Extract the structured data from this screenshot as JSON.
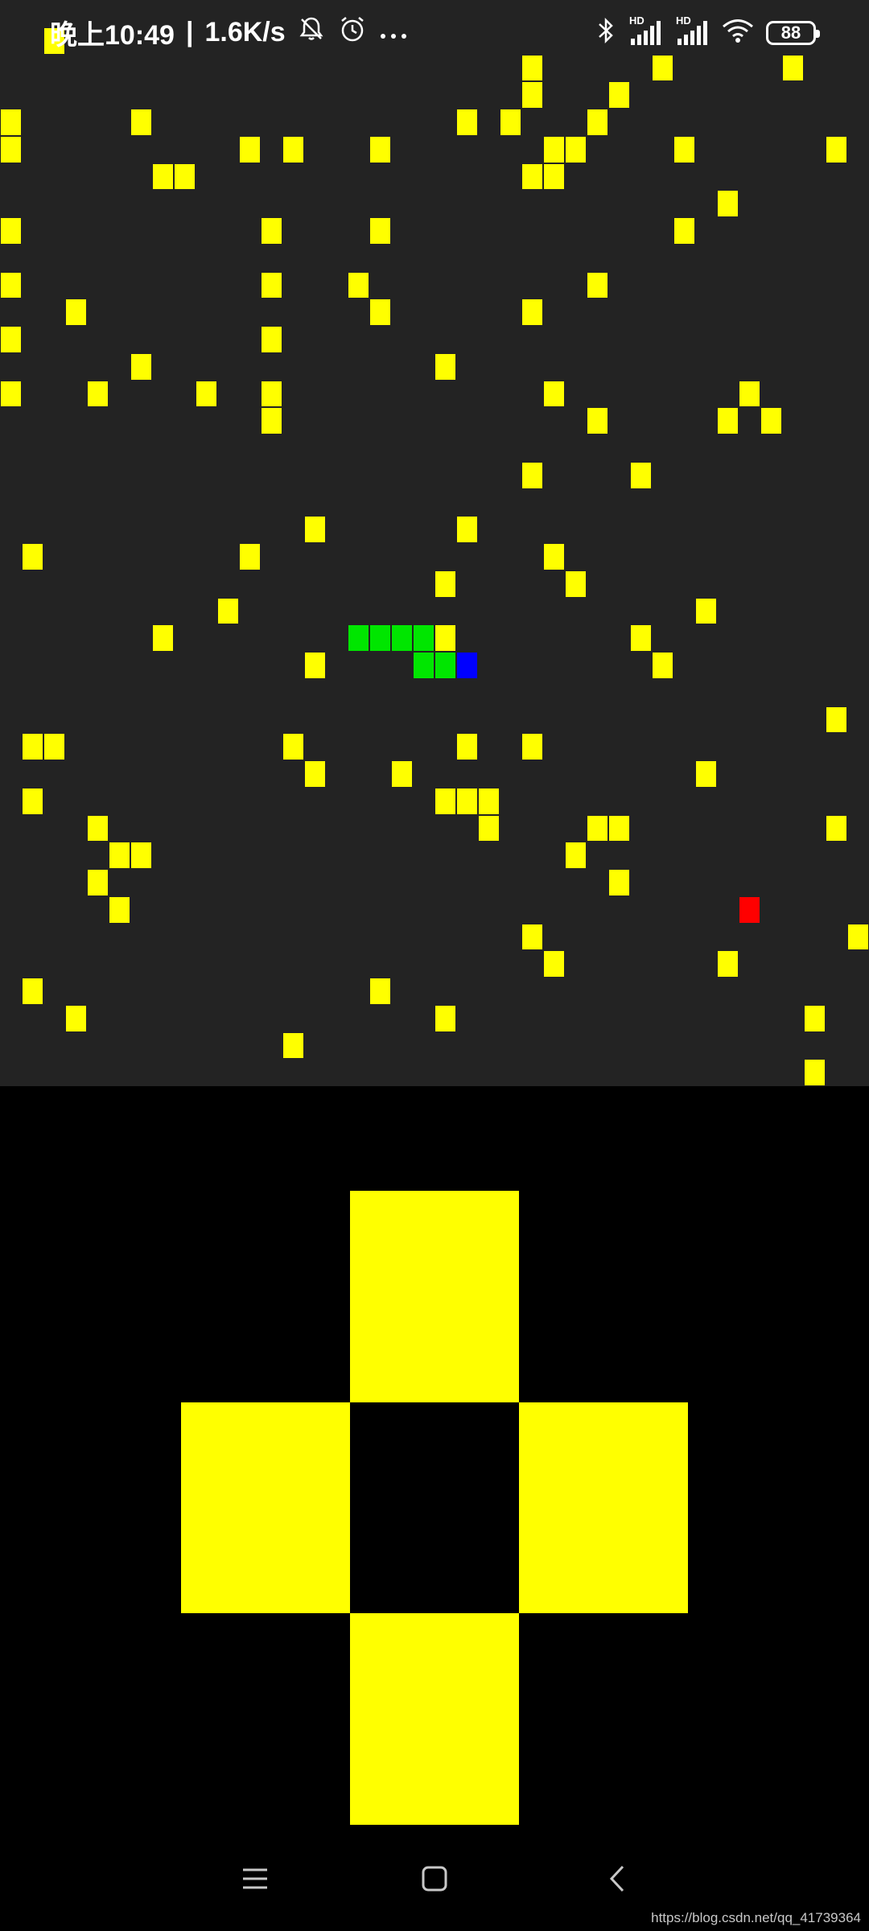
{
  "status_bar": {
    "time": "晚上10:49",
    "net_speed": "1.6K/s",
    "battery": "88",
    "signal_labels": [
      "HD",
      "HD"
    ],
    "icons": [
      "mute-bell-icon",
      "alarm-icon",
      "more-dots-icon",
      "bluetooth-icon",
      "signal-icon",
      "signal-icon",
      "wifi-icon",
      "battery-icon"
    ]
  },
  "game": {
    "cols": 40,
    "rows": 40,
    "colors": {
      "empty": "#232323",
      "wall": "#ffff00",
      "snake_body": "#00e600",
      "snake_head": "#0000ff",
      "food": "#ff0000"
    },
    "walls": [
      [
        2,
        1
      ],
      [
        24,
        2
      ],
      [
        30,
        2
      ],
      [
        36,
        2
      ],
      [
        24,
        3
      ],
      [
        28,
        3
      ],
      [
        0,
        4
      ],
      [
        6,
        4
      ],
      [
        21,
        4
      ],
      [
        23,
        4
      ],
      [
        27,
        4
      ],
      [
        0,
        5
      ],
      [
        11,
        5
      ],
      [
        13,
        5
      ],
      [
        17,
        5
      ],
      [
        25,
        5
      ],
      [
        26,
        5
      ],
      [
        31,
        5
      ],
      [
        38,
        5
      ],
      [
        7,
        6
      ],
      [
        8,
        6
      ],
      [
        24,
        6
      ],
      [
        25,
        6
      ],
      [
        33,
        7
      ],
      [
        0,
        8
      ],
      [
        12,
        8
      ],
      [
        17,
        8
      ],
      [
        31,
        8
      ],
      [
        0,
        10
      ],
      [
        12,
        10
      ],
      [
        16,
        10
      ],
      [
        27,
        10
      ],
      [
        3,
        11
      ],
      [
        17,
        11
      ],
      [
        24,
        11
      ],
      [
        0,
        12
      ],
      [
        12,
        12
      ],
      [
        6,
        13
      ],
      [
        20,
        13
      ],
      [
        0,
        14
      ],
      [
        4,
        14
      ],
      [
        9,
        14
      ],
      [
        12,
        14
      ],
      [
        25,
        14
      ],
      [
        34,
        14
      ],
      [
        12,
        15
      ],
      [
        27,
        15
      ],
      [
        33,
        15
      ],
      [
        35,
        15
      ],
      [
        24,
        17
      ],
      [
        29,
        17
      ],
      [
        14,
        19
      ],
      [
        21,
        19
      ],
      [
        1,
        20
      ],
      [
        11,
        20
      ],
      [
        25,
        20
      ],
      [
        20,
        21
      ],
      [
        26,
        21
      ],
      [
        10,
        22
      ],
      [
        32,
        22
      ],
      [
        7,
        23
      ],
      [
        20,
        23
      ],
      [
        29,
        23
      ],
      [
        14,
        24
      ],
      [
        30,
        24
      ],
      [
        38,
        26
      ],
      [
        1,
        27
      ],
      [
        2,
        27
      ],
      [
        13,
        27
      ],
      [
        21,
        27
      ],
      [
        24,
        27
      ],
      [
        14,
        28
      ],
      [
        18,
        28
      ],
      [
        32,
        28
      ],
      [
        1,
        29
      ],
      [
        20,
        29
      ],
      [
        21,
        29
      ],
      [
        22,
        29
      ],
      [
        4,
        30
      ],
      [
        22,
        30
      ],
      [
        27,
        30
      ],
      [
        28,
        30
      ],
      [
        38,
        30
      ],
      [
        5,
        31
      ],
      [
        6,
        31
      ],
      [
        26,
        31
      ],
      [
        4,
        32
      ],
      [
        28,
        32
      ],
      [
        5,
        33
      ],
      [
        24,
        34
      ],
      [
        39,
        34
      ],
      [
        25,
        35
      ],
      [
        33,
        35
      ],
      [
        1,
        36
      ],
      [
        17,
        36
      ],
      [
        3,
        37
      ],
      [
        20,
        37
      ],
      [
        37,
        37
      ],
      [
        13,
        38
      ],
      [
        37,
        39
      ]
    ],
    "snake": [
      [
        16,
        23
      ],
      [
        17,
        23
      ],
      [
        18,
        23
      ],
      [
        19,
        23
      ],
      [
        19,
        24
      ],
      [
        20,
        24
      ],
      [
        21,
        24
      ]
    ],
    "food": [
      34,
      33
    ]
  },
  "dpad": {
    "up": "up",
    "down": "down",
    "left": "left",
    "right": "right"
  },
  "nav": {
    "buttons": [
      "menu-icon",
      "home-icon",
      "back-icon"
    ]
  },
  "watermark": "https://blog.csdn.net/qq_41739364"
}
